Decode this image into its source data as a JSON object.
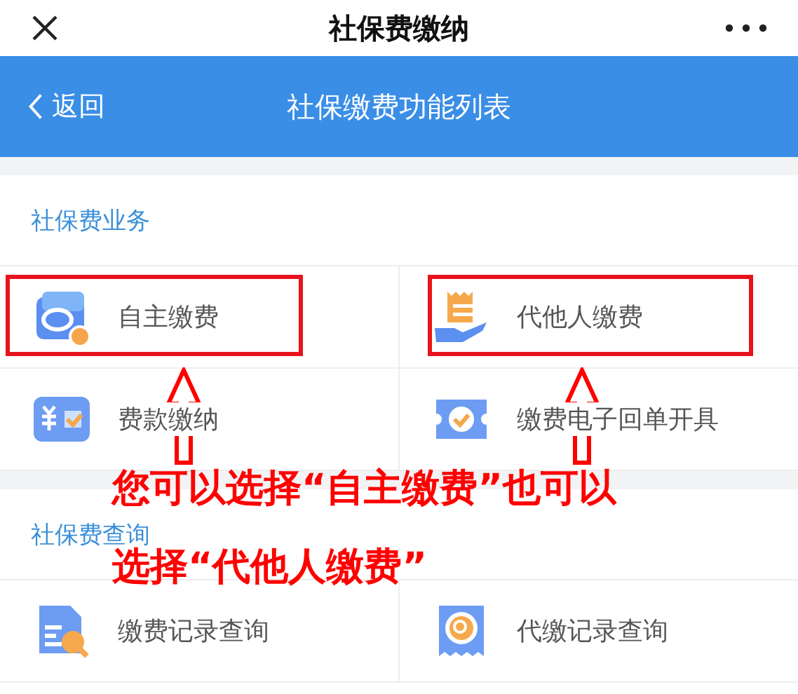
{
  "top_bar": {
    "title": "社保费缴纳"
  },
  "nav_bar": {
    "back": "返回",
    "title": "社保缴费功能列表"
  },
  "sections": [
    {
      "title": "社保费业务",
      "items": [
        {
          "label": "自主缴费",
          "kind": "wallet",
          "highlighted": true
        },
        {
          "label": "代他人缴费",
          "kind": "hand",
          "highlighted": true
        },
        {
          "label": "费款缴纳",
          "kind": "yuan",
          "highlighted": false
        },
        {
          "label": "缴费电子回单开具",
          "kind": "ticket",
          "highlighted": false
        }
      ]
    },
    {
      "title": "社保费查询",
      "items": [
        {
          "label": "缴费记录查询",
          "kind": "doc",
          "highlighted": false
        },
        {
          "label": "代缴记录查询",
          "kind": "receipt",
          "highlighted": false
        }
      ]
    }
  ],
  "annotation": {
    "lines": [
      "您可以选择“自主缴费”也可以",
      "选择“代他人缴费”"
    ]
  }
}
